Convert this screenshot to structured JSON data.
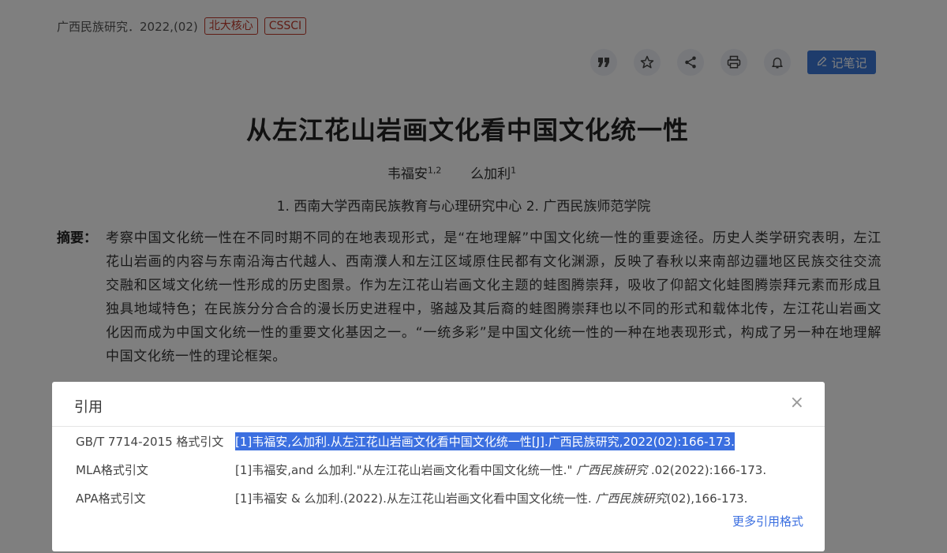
{
  "article": {
    "journal": "广西民族研究．2022,(02)",
    "badges": [
      "北大核心",
      "CSSCI"
    ],
    "title": "从左江花山岩画文化看中国文化统一性",
    "authors": [
      {
        "name": "韦福安",
        "sup": "1,2"
      },
      {
        "name": "么加利",
        "sup": "1"
      }
    ],
    "affiliations": "1. 西南大学西南民族教育与心理研究中心   2. 广西民族师范学院",
    "abstract_label": "摘要：",
    "abstract": "考察中国文化统一性在不同时期不同的在地表现形式，是“在地理解”中国文化统一性的重要途径。历史人类学研究表明，左江花山岩画的内容与东南沿海古代越人、西南濮人和左江区域原住民都有文化渊源，反映了春秋以来南部边疆地区民族交往交流交融和区域文化统一性形成的历史图景。作为左江花山岩画文化主题的蛙图腾崇拜，吸收了仰韶文化蛙图腾崇拜元素而形成且独具地域特色；在民族分分合合的漫长历史进程中，骆越及其后裔的蛙图腾崇拜也以不同的形式和载体北传，左江花山岩画文化因而成为中国文化统一性的重要文化基因之一。“一统多彩”是中国文化统一性的一种在地表现形式，构成了另一种在地理解中国文化统一性的理论框架。"
  },
  "toolbar": {
    "quote_icon": "quote-icon",
    "favorite_icon": "star-icon",
    "share_icon": "share-icon",
    "print_icon": "printer-icon",
    "notify_icon": "bell-icon",
    "note_label": "记笔记"
  },
  "modal": {
    "title": "引用",
    "close": "×",
    "rows": [
      {
        "label": "GB/T 7714-2015 格式引文",
        "text": "[1]韦福安,么加利.从左江花山岩画文化看中国文化统一性[J].广西民族研究,2022(02):166-173.",
        "selected": true
      },
      {
        "label": "MLA格式引文",
        "text_pre": "[1]韦福安,and 么加利.\"从左江花山岩画文化看中国文化统一性.\" ",
        "text_journal": "广西民族研究",
        "text_post": " .02(2022):166-173."
      },
      {
        "label": "APA格式引文",
        "text_pre": "[1]韦福安 & 么加利.(2022).从左江花山岩画文化看中国文化统一性. ",
        "text_journal": "广西民族研究",
        "text_post": "(02),166-173."
      }
    ],
    "more_link": "更多引用格式"
  },
  "colors": {
    "accent": "#3b6fe0",
    "badge": "#c0392b",
    "overlay": "rgba(0,0,0,0.5)"
  }
}
